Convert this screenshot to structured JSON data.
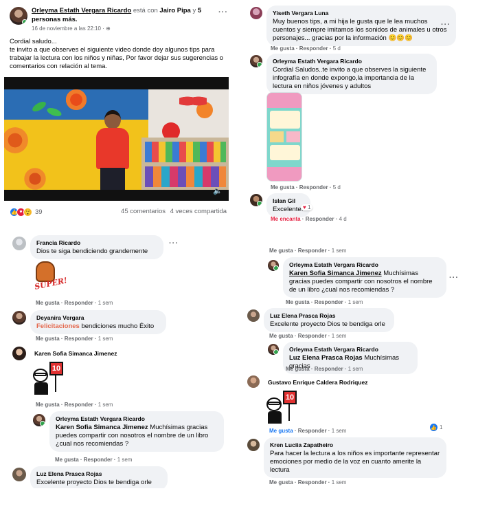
{
  "post": {
    "author": "Orleyma Estath Vergara Ricardo",
    "with_text": "está con",
    "tagged": "Jairo Pipa",
    "and": "y",
    "others": "5 personas más.",
    "date": "16 de noviembre a las 22:10 ·",
    "text_line1": "Cordial saludo...",
    "text_line2": "te invito a que observes el siguiente video donde doy algunos tips para trabajar la lectura con los niños y niñas, Por favor dejar sus sugerencias o comentarios con relación al tema.",
    "reaction_count": "39",
    "comments_count": "45 comentarios",
    "shares_count": "4 veces compartida"
  },
  "panel_b": {
    "c1": {
      "name": "Yiseth Vergara Luna",
      "text": "Muy buenos tips, a mi hija le gusta que le lea muchos cuentos y siempre imitamos los sonidos de animales u otros personajes... gracias por la información 😊😊😊",
      "like": "Me gusta",
      "reply": "Responder",
      "time": "5 d"
    },
    "c2": {
      "name": "Orleyma Estath Vergara Ricardo",
      "text": "Cordial Saludos..te invito a que observes la siguiente infografía en donde expongo,la importancia de la lectura en niños jóvenes y adultos",
      "like": "Me gusta",
      "reply": "Responder",
      "time": "5 d"
    },
    "c3": {
      "name": "Islan Gil",
      "text": "Excelente.",
      "react_count": "1",
      "like": "Me encanta",
      "reply": "Responder",
      "time": "4 d"
    }
  },
  "panel_c": {
    "c1": {
      "name": "Francia Ricardo",
      "text": "Dios te siga bendiciendo grandemente",
      "sticker": "SUPER!",
      "like": "Me gusta",
      "reply": "Responder",
      "time": "1 sem"
    },
    "c2": {
      "name": "Deyanira Vergara",
      "highlight": "Felicitaciones",
      "text": "bendiciones mucho Éxito",
      "like": "Me gusta",
      "reply": "Responder",
      "time": "1 sem"
    },
    "c3": {
      "name": "Karen Sofia Simanca Jimenez",
      "sign": "10",
      "like": "Me gusta",
      "reply": "Responder",
      "time": "1 sem"
    },
    "c4": {
      "name": "Orleyma Estath Vergara Ricardo",
      "tag": "Karen Sofia Simanca Jimenez",
      "text": "Muchísimas gracias puedes compartir con nosotros el nombre de un libro ¿cual nos recomiendas ?",
      "like": "Me gusta",
      "reply": "Responder",
      "time": "1 sem"
    },
    "c5": {
      "name": "Luz Elena Prasca Rojas",
      "text": "Excelente proyecto Dios te bendiga orle"
    }
  },
  "panel_d": {
    "top_actions": {
      "like": "Me gusta",
      "reply": "Responder",
      "time": "1 sem"
    },
    "c1": {
      "name": "Orleyma Estath Vergara Ricardo",
      "tag": "Karen Sofia Simanca Jimenez",
      "text": "Muchísimas gracias puedes compartir con nosotros el nombre de un libro ¿cual nos recomiendas ?",
      "like": "Me gusta",
      "reply": "Responder",
      "time": "1 sem"
    },
    "c2": {
      "name": "Luz Elena Prasca Rojas",
      "text": "Excelente proyecto Dios te bendiga orle",
      "like": "Me gusta",
      "reply": "Responder",
      "time": "1 sem"
    },
    "c3": {
      "name": "Orleyma Estath Vergara Ricardo",
      "tag": "Luz Elena Prasca Rojas",
      "text": "Muchísimas gracias",
      "like": "Me gusta",
      "reply": "Responder",
      "time": "1 sem"
    },
    "c4": {
      "name": "Gustavo Enrique Caldera Rodriquez",
      "sign": "10",
      "like": "Me gusta",
      "reply": "Responder",
      "time": "1 sem",
      "react_count": "1"
    },
    "c5": {
      "name": "Kren Luciia Zapatheiro",
      "text": "Para hacer la lectura a los niños es importante representar emociones por medio de la voz en cuanto amerite la lectura",
      "like": "Me gusta",
      "reply": "Responder",
      "time": "1 sem"
    }
  },
  "colors": {
    "accent": "#1877f2",
    "love": "#e41e3f",
    "online": "#31a24c",
    "bubble": "#f0f2f5"
  }
}
